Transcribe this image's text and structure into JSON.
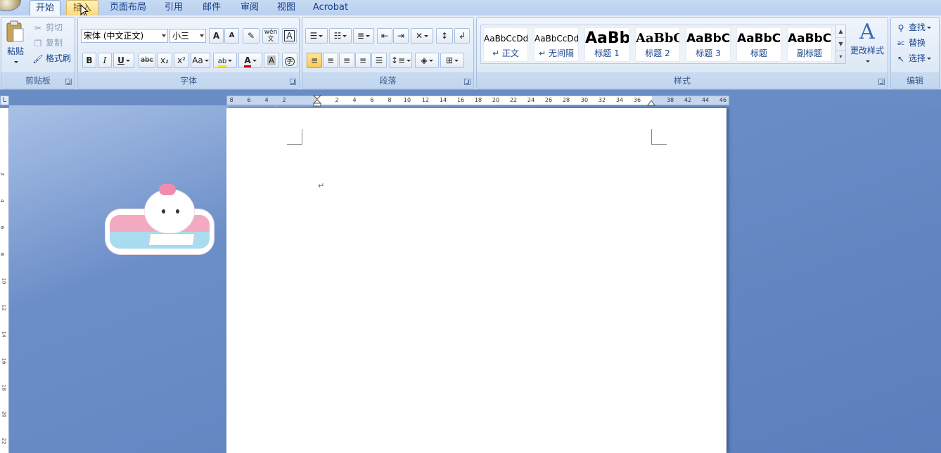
{
  "tabs": [
    {
      "label": "开始",
      "state": "active"
    },
    {
      "label": "插入",
      "state": "hover"
    },
    {
      "label": "页面布局",
      "state": "normal"
    },
    {
      "label": "引用",
      "state": "normal"
    },
    {
      "label": "邮件",
      "state": "normal"
    },
    {
      "label": "审阅",
      "state": "normal"
    },
    {
      "label": "视图",
      "state": "normal"
    },
    {
      "label": "Acrobat",
      "state": "normal"
    }
  ],
  "clipboard": {
    "group_label": "剪贴板",
    "paste_label": "粘贴",
    "cut_label": "剪切",
    "copy_label": "复制",
    "format_painter_label": "格式刷"
  },
  "font": {
    "group_label": "字体",
    "font_name": "宋体 (中文正文)",
    "font_size": "小三",
    "bold": "B",
    "italic": "I",
    "underline": "U",
    "strikethrough": "abc",
    "subscript": "x₂",
    "superscript": "x²",
    "change_case": "Aa",
    "grow": "A",
    "shrink": "A",
    "phonetic": "wén",
    "phonetic_char": "文",
    "border_char": "A",
    "shade_char": "A",
    "enclose_char": "字"
  },
  "paragraph": {
    "group_label": "段落"
  },
  "styles": {
    "group_label": "样式",
    "items": [
      {
        "sample": "AaBbCcDd",
        "name": "↵ 正文"
      },
      {
        "sample": "AaBbCcDd",
        "name": "↵ 无间隔"
      },
      {
        "sample": "AaBb",
        "name": "标题 1"
      },
      {
        "sample": "AaBbC",
        "name": "标题 2"
      },
      {
        "sample": "AaBbC",
        "name": "标题 3"
      },
      {
        "sample": "AaBbC",
        "name": "标题"
      },
      {
        "sample": "AaBbC",
        "name": "副标题"
      }
    ],
    "change_styles_label": "更改样式"
  },
  "editing": {
    "group_label": "编辑",
    "find_label": "查找",
    "replace_label": "替换",
    "select_label": "选择"
  },
  "ruler": {
    "corner": "L",
    "ticks": [
      "8",
      "6",
      "4",
      "2",
      "2",
      "4",
      "6",
      "8",
      "10",
      "12",
      "14",
      "16",
      "18",
      "20",
      "22",
      "24",
      "26",
      "28",
      "30",
      "32",
      "34",
      "36",
      "38",
      "42",
      "44",
      "46",
      "48"
    ],
    "vticks": [
      "2",
      "4",
      "6",
      "8",
      "10",
      "12",
      "14",
      "16",
      "18",
      "20",
      "22"
    ]
  },
  "document": {
    "paragraph_mark": "↵"
  },
  "colors": {
    "accent": "#15428b",
    "ribbon": "#dde8f6",
    "workspace": "#6a8cc4",
    "highlight": "#fbd77b"
  }
}
